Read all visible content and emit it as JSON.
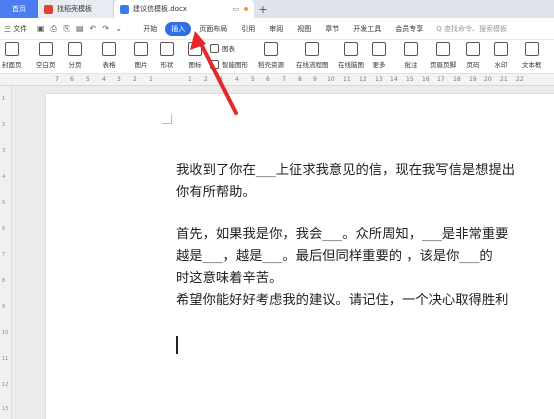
{
  "tabs": {
    "home": "首页",
    "tab1": "找稻壳模板",
    "tab2": "建议信模板.docx",
    "new_tab": "+"
  },
  "menu": {
    "file": "三 文件",
    "tabs": [
      "开始",
      "插入",
      "页面布局",
      "引用",
      "审阅",
      "视图",
      "章节",
      "开发工具",
      "会员专享"
    ],
    "search_placeholder": "Q 查找命令、搜索模板"
  },
  "ribbon": {
    "items": [
      "封面页",
      "空白页",
      "分页",
      "表格",
      "图片",
      "形状",
      "图标",
      "图表",
      "智能图形",
      "稻壳资源",
      "在线流程图",
      "在线脑图",
      "更多",
      "批注",
      "页眉页脚",
      "页码",
      "水印",
      "文本框"
    ]
  },
  "ruler": {
    "numbers": [
      "7",
      "6",
      "5",
      "4",
      "3",
      "2",
      "1",
      "",
      "1",
      "2",
      "3",
      "4",
      "5",
      "6",
      "7",
      "8",
      "9",
      "10",
      "11",
      "12",
      "13",
      "14",
      "15",
      "16",
      "17",
      "18",
      "19",
      "20",
      "21",
      "22"
    ]
  },
  "gutter": {
    "numbers": [
      "1",
      "2",
      "3",
      "4",
      "5",
      "6",
      "7",
      "8",
      "9",
      "10",
      "11",
      "12",
      "13"
    ]
  },
  "document": {
    "lines": [
      "我收到了你在___上征求我意见的信，现在我写信是想提出",
      "你有所帮助。",
      "",
      "首先，如果我是你，我会___。众所周知，___是非常重要",
      "越是___，越是___。最后但同样重要的 ，该是你___的",
      "时这意味着辛苦。",
      "希望你能好好考虑我的建议。请记住，一个决心取得胜利"
    ]
  },
  "colors": {
    "accent": "#2f6fe4",
    "arrow": "#e8262c",
    "home_tab": "#4d7cf0"
  }
}
